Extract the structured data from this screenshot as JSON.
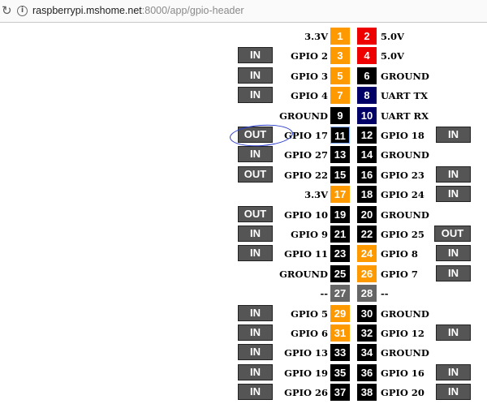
{
  "browser": {
    "reload_icon": "↻",
    "info_icon": "i",
    "url_host": "raspberrypi.mshome.net",
    "url_path": ":8000/app/gpio-header"
  },
  "rows": [
    {
      "left_btn": "",
      "left_label": "3.3V",
      "pin_a": {
        "num": "1",
        "kind": "power33"
      },
      "pin_b": {
        "num": "2",
        "kind": "power5"
      },
      "right_label": "5.0V",
      "right_btn": ""
    },
    {
      "left_btn": "IN",
      "left_label": "GPIO 2",
      "pin_a": {
        "num": "3",
        "kind": "io"
      },
      "pin_b": {
        "num": "4",
        "kind": "power5"
      },
      "right_label": "5.0V",
      "right_btn": ""
    },
    {
      "left_btn": "IN",
      "left_label": "GPIO 3",
      "pin_a": {
        "num": "5",
        "kind": "io"
      },
      "pin_b": {
        "num": "6",
        "kind": "gpio"
      },
      "right_label": "GROUND",
      "right_btn": ""
    },
    {
      "left_btn": "IN",
      "left_label": "GPIO 4",
      "pin_a": {
        "num": "7",
        "kind": "io"
      },
      "pin_b": {
        "num": "8",
        "kind": "uart"
      },
      "right_label": "UART TX",
      "right_btn": ""
    },
    {
      "left_btn": "",
      "left_label": "GROUND",
      "pin_a": {
        "num": "9",
        "kind": "gpio"
      },
      "pin_b": {
        "num": "10",
        "kind": "uart"
      },
      "right_label": "UART RX",
      "right_btn": ""
    },
    {
      "left_btn": "OUT",
      "left_label": "GPIO 17",
      "pin_a": {
        "num": "11",
        "kind": "gpio",
        "selected": true
      },
      "pin_b": {
        "num": "12",
        "kind": "gpio"
      },
      "right_label": "GPIO 18",
      "right_btn": "IN"
    },
    {
      "left_btn": "IN",
      "left_label": "GPIO 27",
      "pin_a": {
        "num": "13",
        "kind": "gpio"
      },
      "pin_b": {
        "num": "14",
        "kind": "gpio"
      },
      "right_label": "GROUND",
      "right_btn": ""
    },
    {
      "left_btn": "OUT",
      "left_label": "GPIO 22",
      "pin_a": {
        "num": "15",
        "kind": "gpio"
      },
      "pin_b": {
        "num": "16",
        "kind": "gpio"
      },
      "right_label": "GPIO 23",
      "right_btn": "IN"
    },
    {
      "left_btn": "",
      "left_label": "3.3V",
      "pin_a": {
        "num": "17",
        "kind": "power33"
      },
      "pin_b": {
        "num": "18",
        "kind": "gpio"
      },
      "right_label": "GPIO 24",
      "right_btn": "IN"
    },
    {
      "left_btn": "OUT",
      "left_label": "GPIO 10",
      "pin_a": {
        "num": "19",
        "kind": "gpio"
      },
      "pin_b": {
        "num": "20",
        "kind": "gpio"
      },
      "right_label": "GROUND",
      "right_btn": ""
    },
    {
      "left_btn": "IN",
      "left_label": "GPIO 9",
      "pin_a": {
        "num": "21",
        "kind": "gpio"
      },
      "pin_b": {
        "num": "22",
        "kind": "gpio"
      },
      "right_label": "GPIO 25",
      "right_btn": "OUT"
    },
    {
      "left_btn": "IN",
      "left_label": "GPIO 11",
      "pin_a": {
        "num": "23",
        "kind": "gpio"
      },
      "pin_b": {
        "num": "24",
        "kind": "io"
      },
      "right_label": "GPIO 8",
      "right_btn": "IN"
    },
    {
      "left_btn": "",
      "left_label": "GROUND",
      "pin_a": {
        "num": "25",
        "kind": "gpio"
      },
      "pin_b": {
        "num": "26",
        "kind": "io"
      },
      "right_label": "GPIO 7",
      "right_btn": "IN"
    },
    {
      "left_btn": "",
      "left_label": "--",
      "pin_a": {
        "num": "27",
        "kind": "id"
      },
      "pin_b": {
        "num": "28",
        "kind": "id"
      },
      "right_label": "--",
      "right_btn": ""
    },
    {
      "left_btn": "IN",
      "left_label": "GPIO 5",
      "pin_a": {
        "num": "29",
        "kind": "io"
      },
      "pin_b": {
        "num": "30",
        "kind": "gpio"
      },
      "right_label": "GROUND",
      "right_btn": ""
    },
    {
      "left_btn": "IN",
      "left_label": "GPIO 6",
      "pin_a": {
        "num": "31",
        "kind": "io"
      },
      "pin_b": {
        "num": "32",
        "kind": "gpio"
      },
      "right_label": "GPIO 12",
      "right_btn": "IN"
    },
    {
      "left_btn": "IN",
      "left_label": "GPIO 13",
      "pin_a": {
        "num": "33",
        "kind": "gpio"
      },
      "pin_b": {
        "num": "34",
        "kind": "gpio"
      },
      "right_label": "GROUND",
      "right_btn": ""
    },
    {
      "left_btn": "IN",
      "left_label": "GPIO 19",
      "pin_a": {
        "num": "35",
        "kind": "gpio"
      },
      "pin_b": {
        "num": "36",
        "kind": "gpio"
      },
      "right_label": "GPIO 16",
      "right_btn": "IN"
    },
    {
      "left_btn": "IN",
      "left_label": "GPIO 26",
      "pin_a": {
        "num": "37",
        "kind": "gpio"
      },
      "pin_b": {
        "num": "38",
        "kind": "gpio"
      },
      "right_label": "GPIO 20",
      "right_btn": "IN"
    }
  ]
}
